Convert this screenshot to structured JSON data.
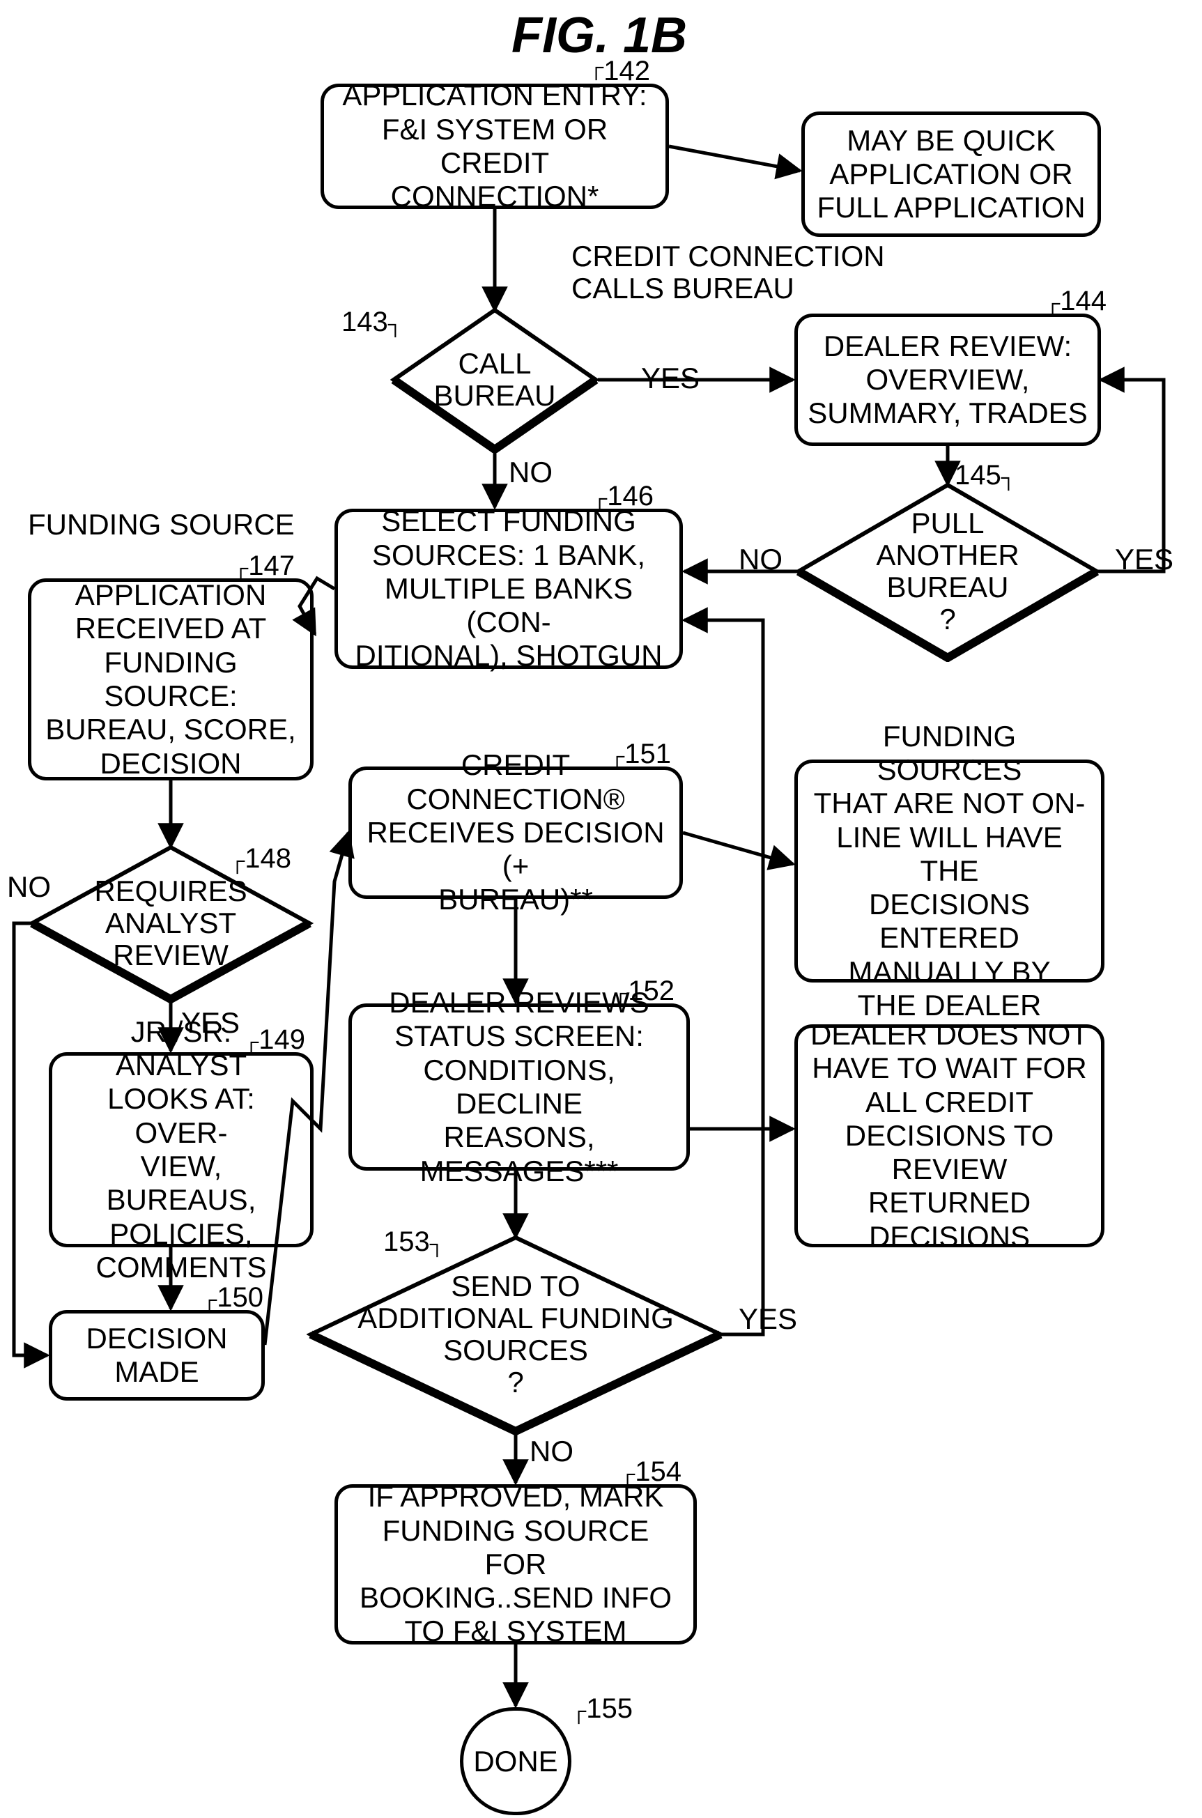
{
  "title": "FIG. 1B",
  "nodes": {
    "n142": {
      "ref": "142",
      "text": "APPLICATION ENTRY:\nF&I SYSTEM OR CREDIT\nCONNECTION*"
    },
    "note_quick": {
      "text": "MAY BE QUICK\nAPPLICATION OR\nFULL APPLICATION"
    },
    "n143": {
      "ref": "143",
      "text": "CALL\nBUREAU"
    },
    "n144": {
      "ref": "144",
      "text": "DEALER REVIEW:\nOVERVIEW,\nSUMMARY, TRADES"
    },
    "n145": {
      "ref": "145",
      "text": "PULL\nANOTHER\nBUREAU\n?"
    },
    "n146": {
      "ref": "146",
      "text": "SELECT FUNDING\nSOURCES: 1 BANK,\nMULTIPLE BANKS (CON-\nDITIONAL), SHOTGUN"
    },
    "n147": {
      "ref": "147",
      "text": "APPLICATION\nRECEIVED AT\nFUNDING SOURCE:\nBUREAU, SCORE,\nDECISION"
    },
    "n148": {
      "ref": "148",
      "text": "REQUIRES\nANALYST\nREVIEW"
    },
    "n149": {
      "ref": "149",
      "text": "JR./SR. ANALYST\nLOOKS AT: OVER-\nVIEW, BUREAUS,\nPOLICIES,\nCOMMENTS"
    },
    "n150": {
      "ref": "150",
      "text": "DECISION\nMADE"
    },
    "n151": {
      "ref": "151",
      "text": "CREDIT CONNECTION®\nRECEIVES DECISION (+\nBUREAU)**"
    },
    "n152": {
      "ref": "152",
      "text": "DEALER REVIEWS\nSTATUS SCREEN:\nCONDITIONS, DECLINE\nREASONS, MESSAGES***"
    },
    "n153": {
      "ref": "153",
      "text": "SEND TO\nADDITIONAL FUNDING\nSOURCES\n?"
    },
    "n154": {
      "ref": "154",
      "text": "IF APPROVED, MARK\nFUNDING SOURCE FOR\nBOOKING..SEND INFO\nTO F&I SYSTEM"
    },
    "n155": {
      "ref": "155",
      "text": "DONE"
    },
    "note_manual": {
      "text": "FUNDING SOURCES\nTHAT ARE NOT ON-\nLINE WILL HAVE THE\nDECISIONS ENTERED\nMANUALLY BY\nTHE DEALER"
    },
    "note_nowait": {
      "text": "DEALER DOES NOT\nHAVE TO WAIT FOR\nALL CREDIT\nDECISIONS TO\nREVIEW RETURNED\nDECISIONS"
    }
  },
  "labels": {
    "funding_source_header": "FUNDING SOURCE",
    "credit_conn_calls": "CREDIT CONNECTION\nCALLS BUREAU",
    "yes": "YES",
    "no": "NO"
  },
  "chart_data": {
    "type": "flowchart",
    "nodes": [
      {
        "id": "142",
        "type": "process",
        "label": "APPLICATION ENTRY: F&I SYSTEM OR CREDIT CONNECTION*"
      },
      {
        "id": "note_quick",
        "type": "note",
        "label": "MAY BE QUICK APPLICATION OR FULL APPLICATION"
      },
      {
        "id": "143",
        "type": "decision",
        "label": "CALL BUREAU"
      },
      {
        "id": "144",
        "type": "process",
        "label": "DEALER REVIEW: OVERVIEW, SUMMARY, TRADES"
      },
      {
        "id": "145",
        "type": "decision",
        "label": "PULL ANOTHER BUREAU?"
      },
      {
        "id": "146",
        "type": "process",
        "label": "SELECT FUNDING SOURCES: 1 BANK, MULTIPLE BANKS (CONDITIONAL), SHOTGUN"
      },
      {
        "id": "147",
        "type": "process",
        "label": "APPLICATION RECEIVED AT FUNDING SOURCE: BUREAU, SCORE, DECISION"
      },
      {
        "id": "148",
        "type": "decision",
        "label": "REQUIRES ANALYST REVIEW"
      },
      {
        "id": "149",
        "type": "process",
        "label": "JR./SR. ANALYST LOOKS AT: OVERVIEW, BUREAUS, POLICIES, COMMENTS"
      },
      {
        "id": "150",
        "type": "process",
        "label": "DECISION MADE"
      },
      {
        "id": "151",
        "type": "process",
        "label": "CREDIT CONNECTION® RECEIVES DECISION (+ BUREAU)**"
      },
      {
        "id": "note_manual",
        "type": "note",
        "label": "FUNDING SOURCES THAT ARE NOT ON-LINE WILL HAVE THE DECISIONS ENTERED MANUALLY BY THE DEALER"
      },
      {
        "id": "152",
        "type": "process",
        "label": "DEALER REVIEWS STATUS SCREEN: CONDITIONS, DECLINE REASONS, MESSAGES***"
      },
      {
        "id": "note_nowait",
        "type": "note",
        "label": "DEALER DOES NOT HAVE TO WAIT FOR ALL CREDIT DECISIONS TO REVIEW RETURNED DECISIONS"
      },
      {
        "id": "153",
        "type": "decision",
        "label": "SEND TO ADDITIONAL FUNDING SOURCES?"
      },
      {
        "id": "154",
        "type": "process",
        "label": "IF APPROVED, MARK FUNDING SOURCE FOR BOOKING..SEND INFO TO F&I SYSTEM"
      },
      {
        "id": "155",
        "type": "terminator",
        "label": "DONE"
      }
    ],
    "edges": [
      {
        "from": "142",
        "to": "note_quick",
        "label": ""
      },
      {
        "from": "142",
        "to": "143",
        "label": "CREDIT CONNECTION CALLS BUREAU"
      },
      {
        "from": "143",
        "to": "144",
        "label": "YES"
      },
      {
        "from": "143",
        "to": "146",
        "label": "NO"
      },
      {
        "from": "144",
        "to": "145",
        "label": ""
      },
      {
        "from": "145",
        "to": "144",
        "label": "YES"
      },
      {
        "from": "145",
        "to": "146",
        "label": "NO"
      },
      {
        "from": "146",
        "to": "147",
        "label": "",
        "style": "zigzag"
      },
      {
        "from": "147",
        "to": "148",
        "label": ""
      },
      {
        "from": "148",
        "to": "149",
        "label": "YES"
      },
      {
        "from": "148",
        "to": "150",
        "label": "NO"
      },
      {
        "from": "149",
        "to": "150",
        "label": ""
      },
      {
        "from": "150",
        "to": "151",
        "label": "",
        "style": "zigzag"
      },
      {
        "from": "151",
        "to": "note_manual",
        "label": ""
      },
      {
        "from": "151",
        "to": "152",
        "label": ""
      },
      {
        "from": "152",
        "to": "note_nowait",
        "label": ""
      },
      {
        "from": "152",
        "to": "153",
        "label": ""
      },
      {
        "from": "153",
        "to": "146",
        "label": "YES"
      },
      {
        "from": "153",
        "to": "154",
        "label": "NO"
      },
      {
        "from": "154",
        "to": "155",
        "label": ""
      }
    ]
  }
}
